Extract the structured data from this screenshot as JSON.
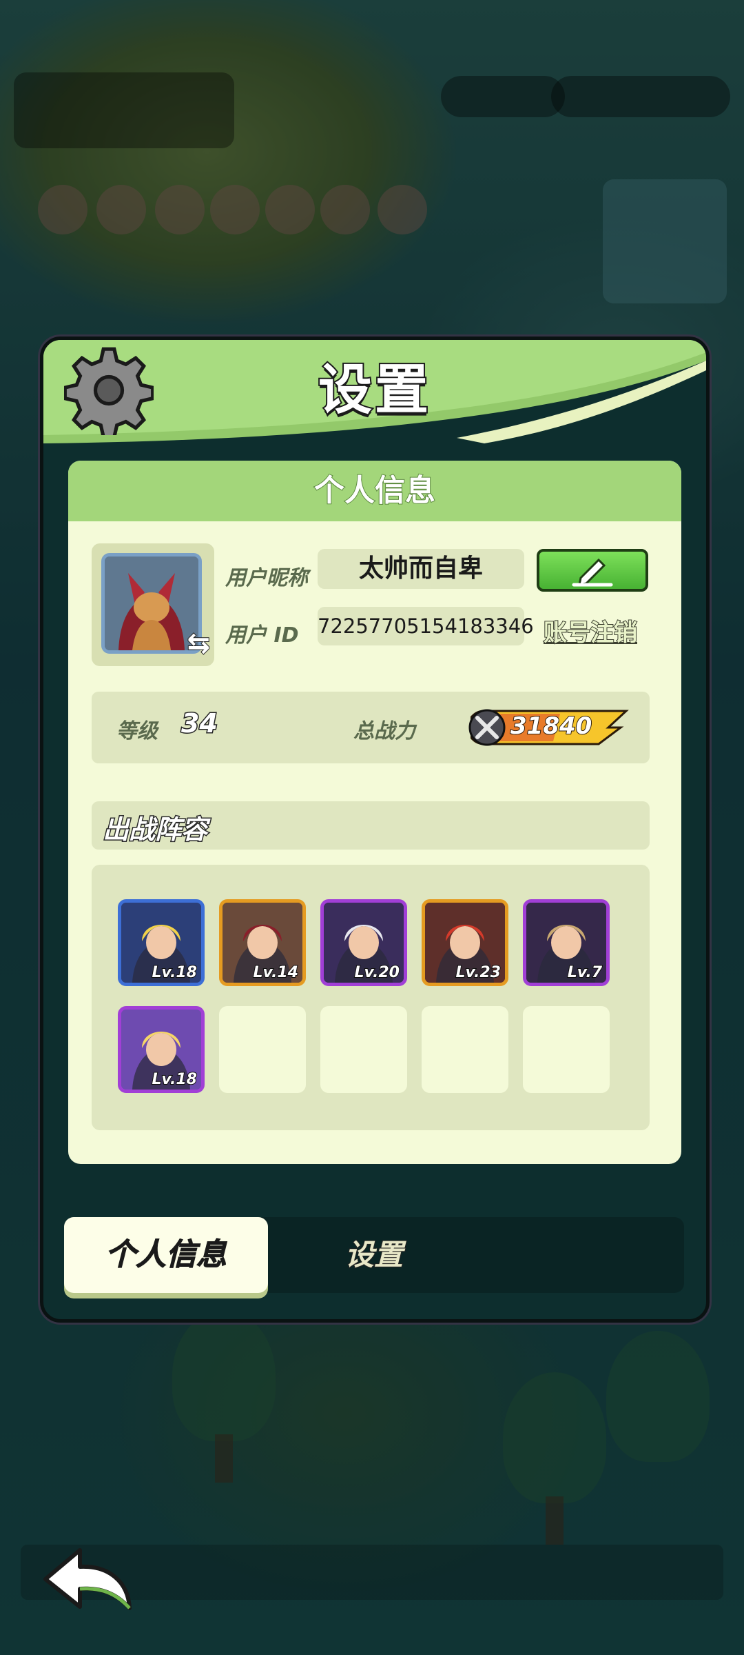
{
  "panel": {
    "title": "设置"
  },
  "profile_section": {
    "header": "个人信息",
    "nickname_label": "用户昵称",
    "nickname_value": "太帅而自卑",
    "id_label": "用户 ID",
    "id_value": "72257705154183346",
    "cancel_account": "账号注销"
  },
  "stats": {
    "level_label": "等级",
    "level_value": "34",
    "power_label": "总战力",
    "power_value": "31840"
  },
  "lineup": {
    "title": "出战阵容",
    "heroes": [
      {
        "level": "Lv.18",
        "frame": "#3d6fd6",
        "bg": "#2c3f78",
        "hair": "#f2d24a"
      },
      {
        "level": "Lv.14",
        "frame": "#e59b21",
        "bg": "#6a4a3a",
        "hair": "#8a1f2a"
      },
      {
        "level": "Lv.20",
        "frame": "#a13fd6",
        "bg": "#3a2d5c",
        "hair": "#e7e7ee"
      },
      {
        "level": "Lv.23",
        "frame": "#e59b21",
        "bg": "#5e2f2a",
        "hair": "#d43a2a"
      },
      {
        "level": "Lv.7",
        "frame": "#a13fd6",
        "bg": "#35284a",
        "hair": "#c9a870"
      },
      {
        "level": "Lv.18",
        "frame": "#a13fd6",
        "bg": "#6e4bb0",
        "hair": "#f6d667"
      }
    ],
    "empty_slots": 4
  },
  "tabs": {
    "personal": "个人信息",
    "settings": "设置"
  },
  "icons": {
    "settings": "gear-icon",
    "edit": "pencil-icon",
    "swap": "swap-arrows-icon",
    "power": "crossed-swords-icon",
    "back": "back-arrow-icon"
  },
  "colors": {
    "accent_green": "#a3d67a",
    "edit_button": "#48b233",
    "power_badge": "#f6c52b"
  }
}
